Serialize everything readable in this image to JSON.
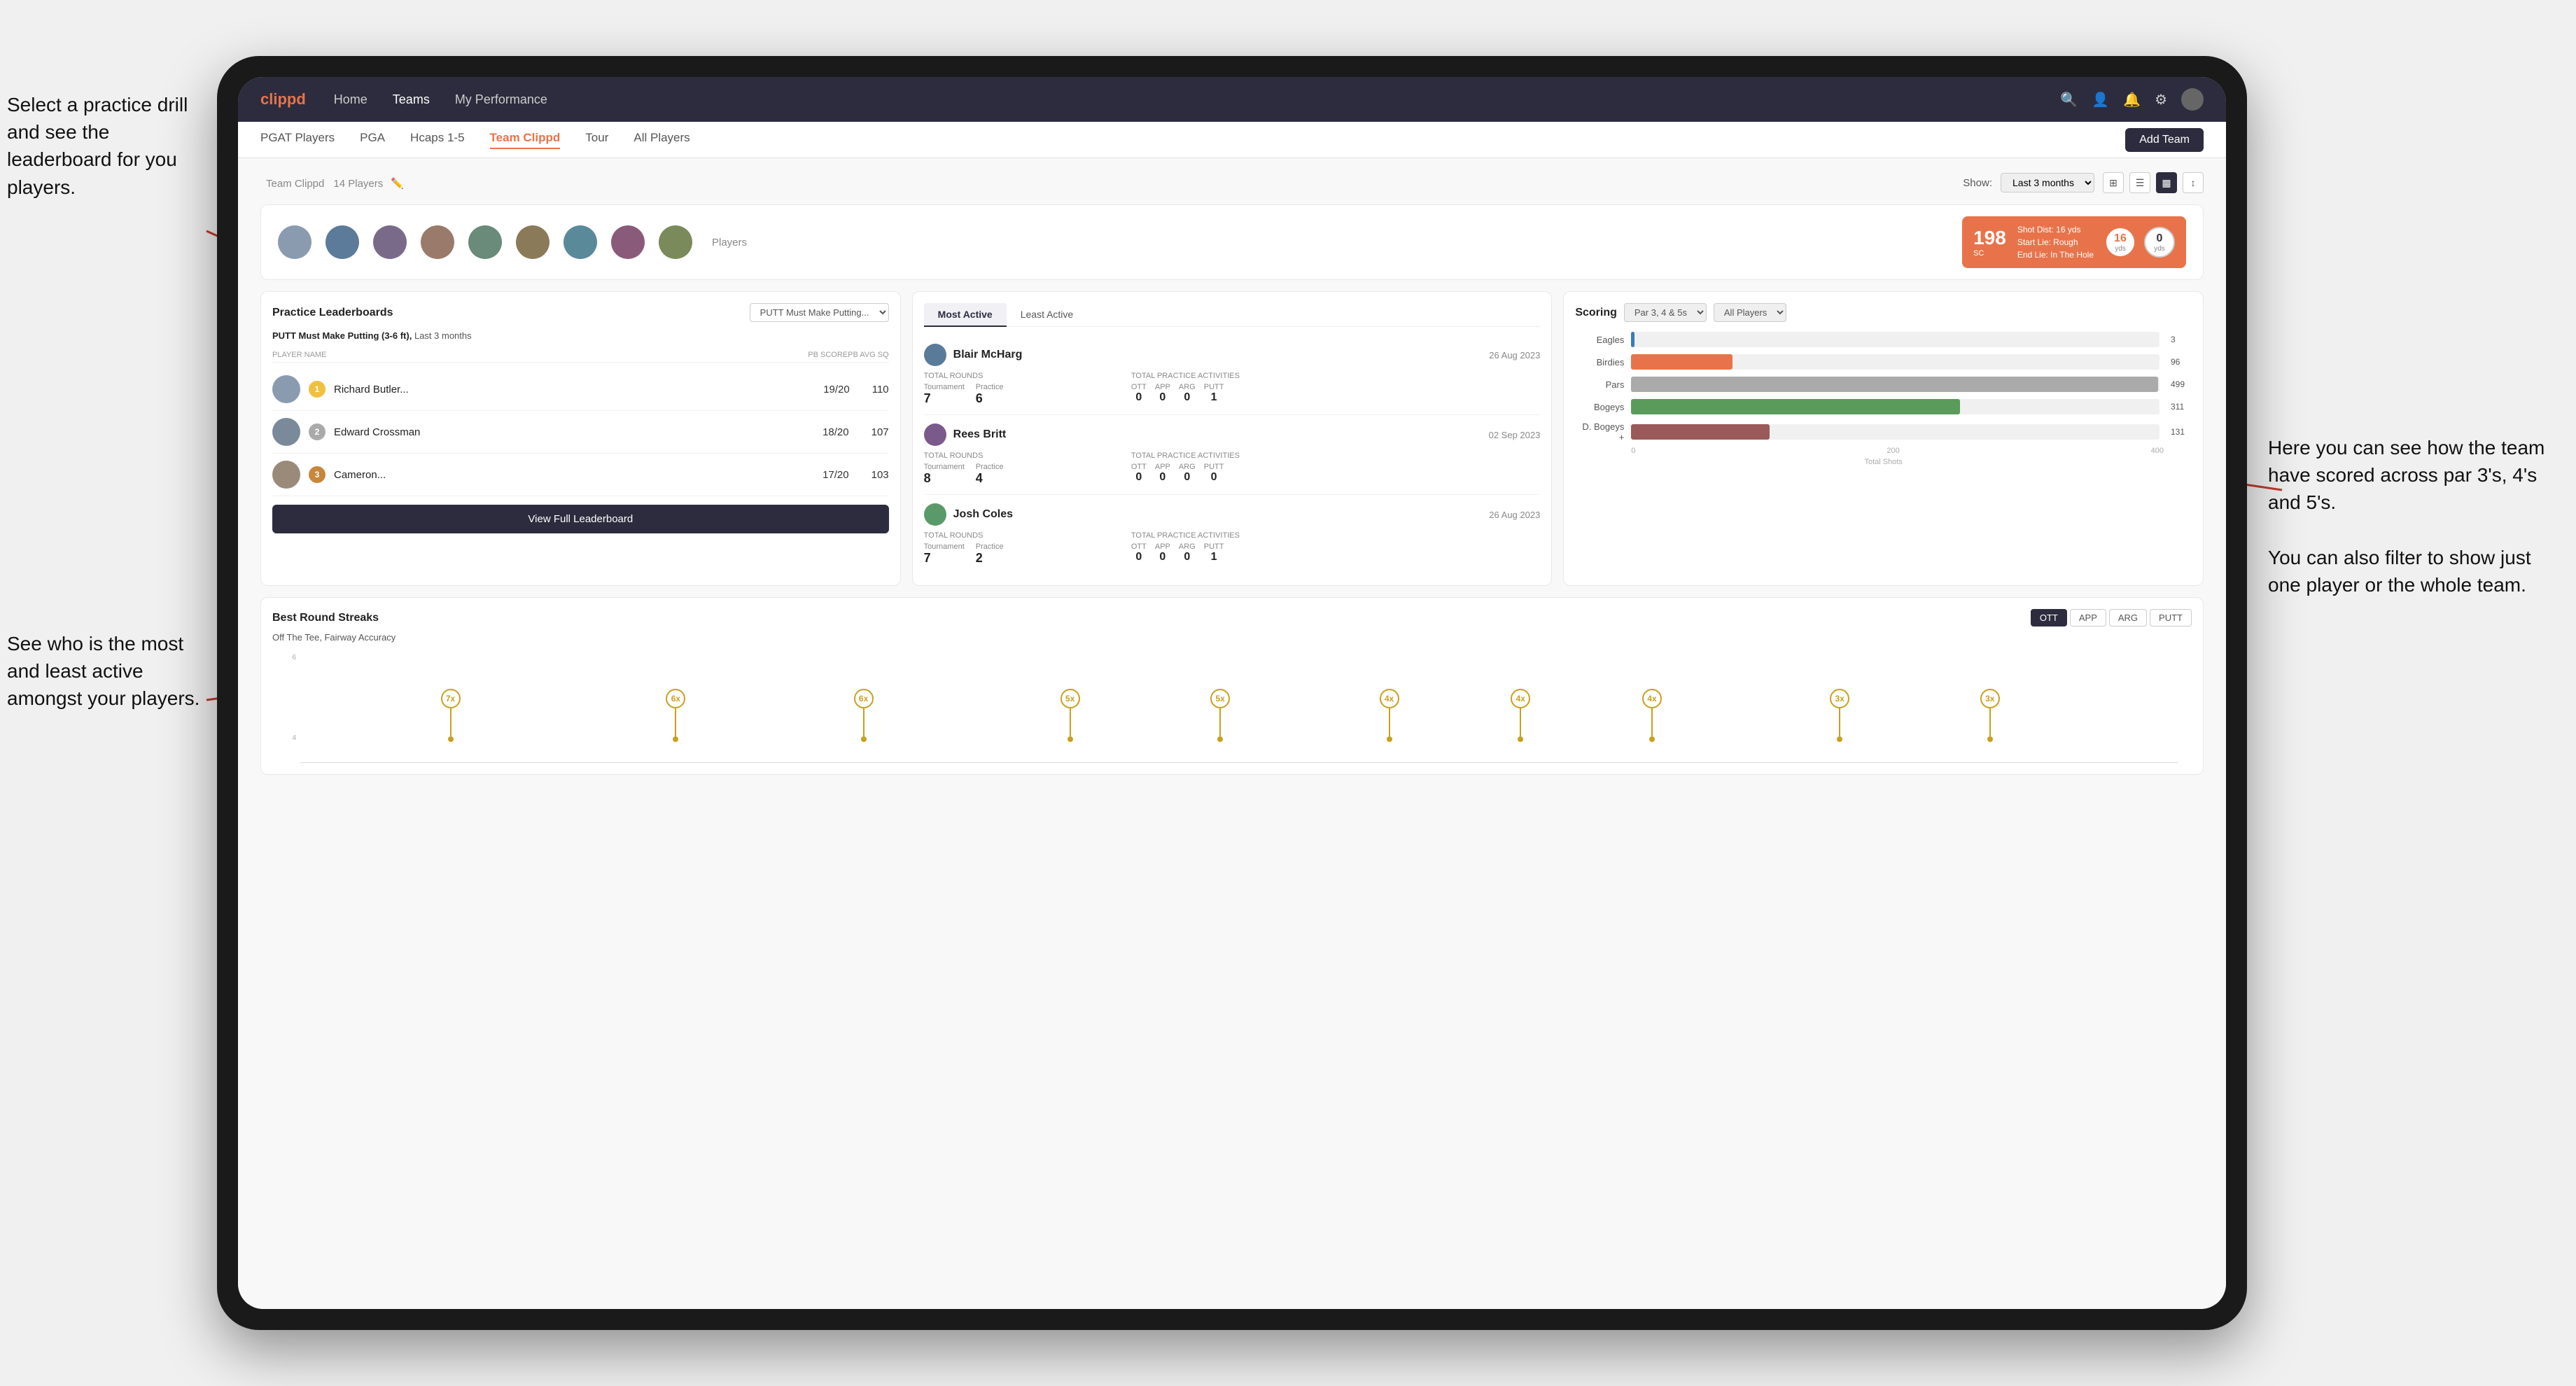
{
  "annotations": {
    "top_left": "Select a practice drill and see the leaderboard for you players.",
    "bottom_left": "See who is the most and least active amongst your players.",
    "right": "Here you can see how the team have scored across par 3's, 4's and 5's.\n\nYou can also filter to show just one player or the whole team."
  },
  "navbar": {
    "brand": "clippd",
    "links": [
      "Home",
      "Teams",
      "My Performance"
    ],
    "active_link": "Teams"
  },
  "subnav": {
    "links": [
      "PGAT Players",
      "PGA",
      "Hcaps 1-5",
      "Team Clippd",
      "Tour",
      "All Players"
    ],
    "active_link": "Team Clippd",
    "add_team_label": "Add Team"
  },
  "team": {
    "title": "Team Clippd",
    "player_count": "14 Players",
    "show_label": "Show:",
    "show_period": "Last 3 months",
    "players_label": "Players"
  },
  "shot_card": {
    "number": "198",
    "label": "SC",
    "shot_dist": "Shot Dist: 16 yds",
    "start_lie": "Start Lie: Rough",
    "end_lie": "End Lie: In The Hole",
    "yds1_value": "16",
    "yds1_label": "yds",
    "yds2_value": "0",
    "yds2_label": "yds"
  },
  "practice_leaderboards": {
    "title": "Practice Leaderboards",
    "dropdown": "PUTT Must Make Putting...",
    "subtitle": "PUTT Must Make Putting (3-6 ft),",
    "period": "Last 3 months",
    "col_player": "PLAYER NAME",
    "col_score": "PB SCORE",
    "col_avg": "PB AVG SQ",
    "players": [
      {
        "rank": 1,
        "rank_type": "gold",
        "name": "Richard Butler...",
        "score": "19/20",
        "avg": "110"
      },
      {
        "rank": 2,
        "rank_type": "silver",
        "name": "Edward Crossman",
        "score": "18/20",
        "avg": "107"
      },
      {
        "rank": 3,
        "rank_type": "bronze",
        "name": "Cameron...",
        "score": "17/20",
        "avg": "103"
      }
    ],
    "view_btn": "View Full Leaderboard"
  },
  "activity": {
    "tabs": [
      "Most Active",
      "Least Active"
    ],
    "active_tab": "Most Active",
    "players": [
      {
        "name": "Blair McHarg",
        "date": "26 Aug 2023",
        "total_rounds_label": "Total Rounds",
        "tournament_label": "Tournament",
        "tournament_value": "7",
        "practice_label": "Practice",
        "practice_value": "6",
        "total_practice_label": "Total Practice Activities",
        "ott_label": "OTT",
        "ott_value": "0",
        "app_label": "APP",
        "app_value": "0",
        "arg_label": "ARG",
        "arg_value": "0",
        "putt_label": "PUTT",
        "putt_value": "1"
      },
      {
        "name": "Rees Britt",
        "date": "02 Sep 2023",
        "total_rounds_label": "Total Rounds",
        "tournament_label": "Tournament",
        "tournament_value": "8",
        "practice_label": "Practice",
        "practice_value": "4",
        "total_practice_label": "Total Practice Activities",
        "ott_label": "OTT",
        "ott_value": "0",
        "app_label": "APP",
        "app_value": "0",
        "arg_label": "ARG",
        "arg_value": "0",
        "putt_label": "PUTT",
        "putt_value": "0"
      },
      {
        "name": "Josh Coles",
        "date": "26 Aug 2023",
        "total_rounds_label": "Total Rounds",
        "tournament_label": "Tournament",
        "tournament_value": "7",
        "practice_label": "Practice",
        "practice_value": "2",
        "total_practice_label": "Total Practice Activities",
        "ott_label": "OTT",
        "ott_value": "0",
        "app_label": "APP",
        "app_value": "0",
        "arg_label": "ARG",
        "arg_value": "0",
        "putt_label": "PUTT",
        "putt_value": "1"
      }
    ]
  },
  "scoring": {
    "title": "Scoring",
    "filter1": "Par 3, 4 & 5s",
    "filter2": "All Players",
    "bars": [
      {
        "label": "Eagles",
        "value": 3,
        "max": 500,
        "type": "eagles",
        "color": "#3a7abd"
      },
      {
        "label": "Birdies",
        "value": 96,
        "max": 500,
        "type": "birdies",
        "color": "#e8734a"
      },
      {
        "label": "Pars",
        "value": 499,
        "max": 500,
        "type": "pars",
        "color": "#aaa"
      },
      {
        "label": "Bogeys",
        "value": 311,
        "max": 500,
        "type": "bogeys",
        "color": "#5a9a5a"
      },
      {
        "label": "D. Bogeys +",
        "value": 131,
        "max": 500,
        "type": "d-bogeys",
        "color": "#9a5a5a"
      }
    ],
    "axis_labels": [
      "0",
      "200",
      "400"
    ],
    "axis_title": "Total Shots"
  },
  "streaks": {
    "title": "Best Round Streaks",
    "filter_btns": [
      "OTT",
      "APP",
      "ARG",
      "PUTT"
    ],
    "active_btn": "OTT",
    "subtitle": "Off The Tee, Fairway Accuracy",
    "pins": [
      {
        "label": "7x",
        "x_pct": 8
      },
      {
        "label": "6x",
        "x_pct": 20
      },
      {
        "label": "6x",
        "x_pct": 30
      },
      {
        "label": "5x",
        "x_pct": 41
      },
      {
        "label": "5x",
        "x_pct": 49
      },
      {
        "label": "4x",
        "x_pct": 58
      },
      {
        "label": "4x",
        "x_pct": 65
      },
      {
        "label": "4x",
        "x_pct": 72
      },
      {
        "label": "3x",
        "x_pct": 82
      },
      {
        "label": "3x",
        "x_pct": 90
      }
    ]
  }
}
